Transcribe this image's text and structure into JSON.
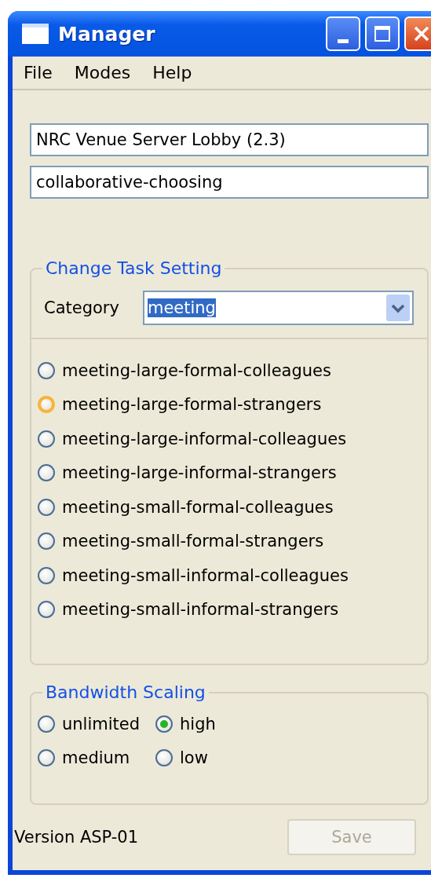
{
  "window": {
    "title": "Manager"
  },
  "menu": [
    "File",
    "Modes",
    "Help"
  ],
  "fields": [
    {
      "value": "NRC Venue Server Lobby (2.3)"
    },
    {
      "value": "collaborative-choosing"
    }
  ],
  "task_setting": {
    "title": "Change Task Setting",
    "category_label": "Category",
    "category_value": "meeting",
    "options": [
      {
        "label": "meeting-large-formal-colleagues",
        "selected": false,
        "hovered": false
      },
      {
        "label": "meeting-large-formal-strangers",
        "selected": false,
        "hovered": true
      },
      {
        "label": "meeting-large-informal-colleagues",
        "selected": false,
        "hovered": false
      },
      {
        "label": "meeting-large-informal-strangers",
        "selected": false,
        "hovered": false
      },
      {
        "label": "meeting-small-formal-colleagues",
        "selected": false,
        "hovered": false
      },
      {
        "label": "meeting-small-formal-strangers",
        "selected": false,
        "hovered": false
      },
      {
        "label": "meeting-small-informal-colleagues",
        "selected": false,
        "hovered": false
      },
      {
        "label": "meeting-small-informal-strangers",
        "selected": false,
        "hovered": false
      }
    ]
  },
  "bandwidth": {
    "title": "Bandwidth Scaling",
    "options": [
      {
        "label": "unlimited",
        "selected": false
      },
      {
        "label": "high",
        "selected": true
      },
      {
        "label": "medium",
        "selected": false
      },
      {
        "label": "low",
        "selected": false
      }
    ]
  },
  "version": "Version ASP-01",
  "save_button": {
    "label": "Save",
    "disabled": true
  }
}
